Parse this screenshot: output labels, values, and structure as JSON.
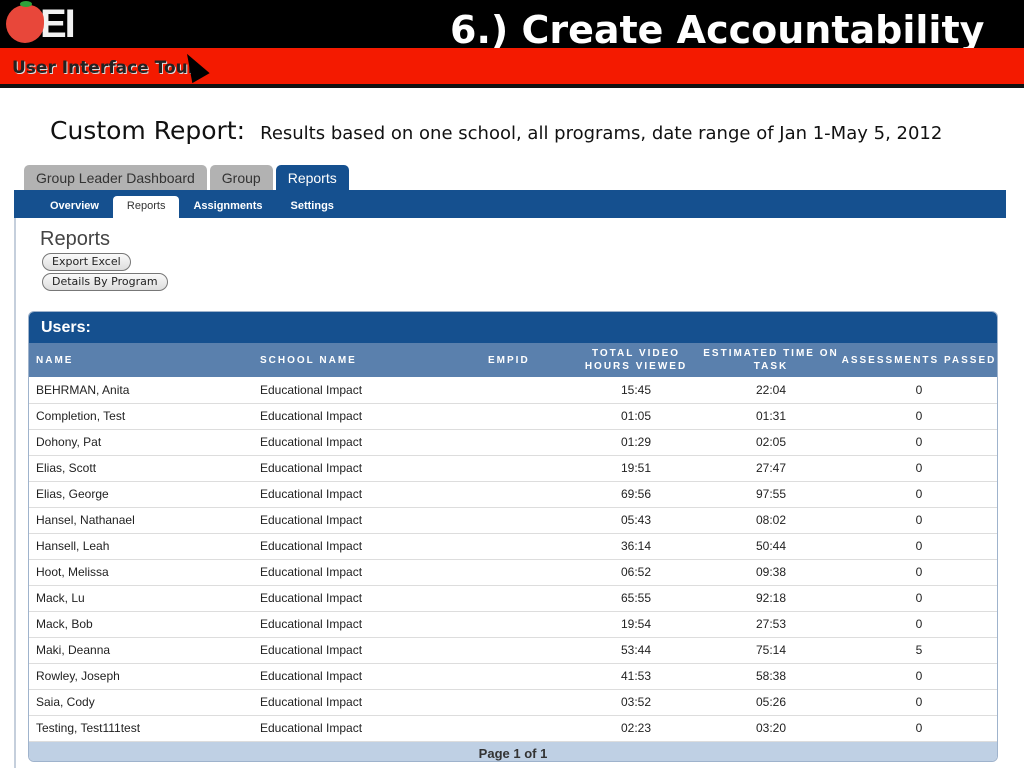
{
  "slide": {
    "logo_text": "EI",
    "title": "6.)  Create Accountability",
    "tour_label": "User Interface Tour",
    "subtitle_main": "Custom Report:",
    "subtitle_detail": "Results based on one school, all programs, date range of Jan 1-May 5, 2012"
  },
  "main_tabs": [
    "Group Leader Dashboard",
    "Group",
    "Reports"
  ],
  "sub_tabs": [
    "Overview",
    "Reports",
    "Assignments",
    "Settings"
  ],
  "page": {
    "heading": "Reports",
    "export_button": "Export Excel",
    "details_button": "Details By Program"
  },
  "users": {
    "title": "Users:",
    "columns": [
      "NAME",
      "SCHOOL NAME",
      "EMPID",
      "TOTAL VIDEO HOURS VIEWED",
      "ESTIMATED TIME ON TASK",
      "ASSESSMENTS PASSED"
    ],
    "rows": [
      [
        "BEHRMAN, Anita",
        "Educational Impact",
        "",
        "15:45",
        "22:04",
        "0"
      ],
      [
        "Completion, Test",
        "Educational Impact",
        "",
        "01:05",
        "01:31",
        "0"
      ],
      [
        "Dohony, Pat",
        "Educational Impact",
        "",
        "01:29",
        "02:05",
        "0"
      ],
      [
        "Elias, Scott",
        "Educational Impact",
        "",
        "19:51",
        "27:47",
        "0"
      ],
      [
        "Elias, George",
        "Educational Impact",
        "",
        "69:56",
        "97:55",
        "0"
      ],
      [
        "Hansel, Nathanael",
        "Educational Impact",
        "",
        "05:43",
        "08:02",
        "0"
      ],
      [
        "Hansell, Leah",
        "Educational Impact",
        "",
        "36:14",
        "50:44",
        "0"
      ],
      [
        "Hoot, Melissa",
        "Educational Impact",
        "",
        "06:52",
        "09:38",
        "0"
      ],
      [
        "Mack, Lu",
        "Educational Impact",
        "",
        "65:55",
        "92:18",
        "0"
      ],
      [
        "Mack, Bob",
        "Educational Impact",
        "",
        "19:54",
        "27:53",
        "0"
      ],
      [
        "Maki, Deanna",
        "Educational Impact",
        "",
        "53:44",
        "75:14",
        "5"
      ],
      [
        "Rowley, Joseph",
        "Educational Impact",
        "",
        "41:53",
        "58:38",
        "0"
      ],
      [
        "Saia, Cody",
        "Educational Impact",
        "",
        "03:52",
        "05:26",
        "0"
      ],
      [
        "Testing, Test111test",
        "Educational Impact",
        "",
        "02:23",
        "03:20",
        "0"
      ]
    ],
    "pagination": "Page 1 of 1"
  }
}
